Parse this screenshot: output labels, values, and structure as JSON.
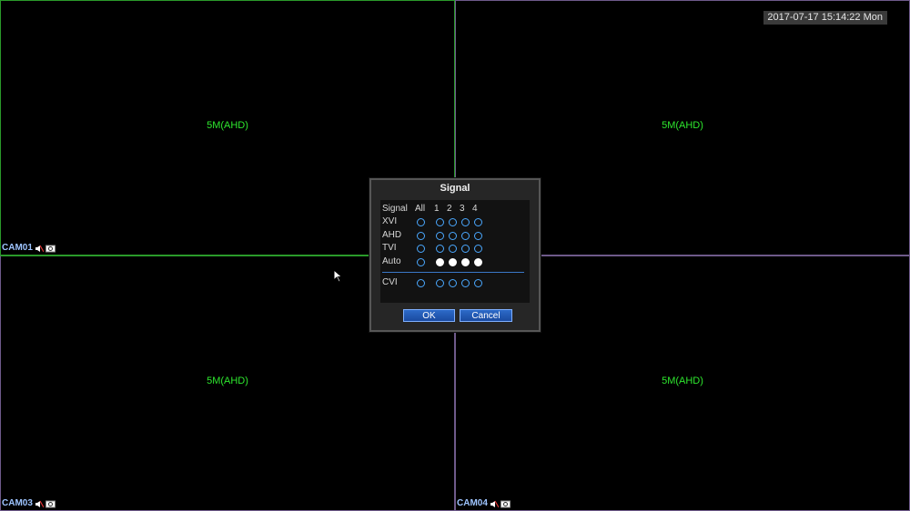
{
  "datetime": "2017-07-17 15:14:22 Mon",
  "cameras": [
    {
      "label": "CAM01",
      "signal": "5M(AHD)"
    },
    {
      "label": "",
      "signal": "5M(AHD)"
    },
    {
      "label": "CAM03",
      "signal": "5M(AHD)"
    },
    {
      "label": "CAM04",
      "signal": "5M(AHD)"
    }
  ],
  "icons": {
    "audio": "mute-speaker-icon",
    "record": "camera-record-icon"
  },
  "dialog": {
    "title": "Signal",
    "header_label": "Signal",
    "columns": [
      "All",
      "1",
      "2",
      "3",
      "4"
    ],
    "rows": [
      {
        "label": "XVI",
        "selected": [
          false,
          false,
          false,
          false,
          false
        ]
      },
      {
        "label": "AHD",
        "selected": [
          false,
          false,
          false,
          false,
          false
        ]
      },
      {
        "label": "TVI",
        "selected": [
          false,
          false,
          false,
          false,
          false
        ]
      },
      {
        "label": "Auto",
        "selected": [
          false,
          true,
          true,
          true,
          true
        ]
      }
    ],
    "extra_row": {
      "label": "CVI",
      "selected": [
        false,
        false,
        false,
        false,
        false
      ]
    },
    "ok_label": "OK",
    "cancel_label": "Cancel"
  },
  "colors": {
    "signal_text": "#2ee82e",
    "radio_border": "#4aa8ff",
    "button_blue": "#1a4aa0"
  }
}
